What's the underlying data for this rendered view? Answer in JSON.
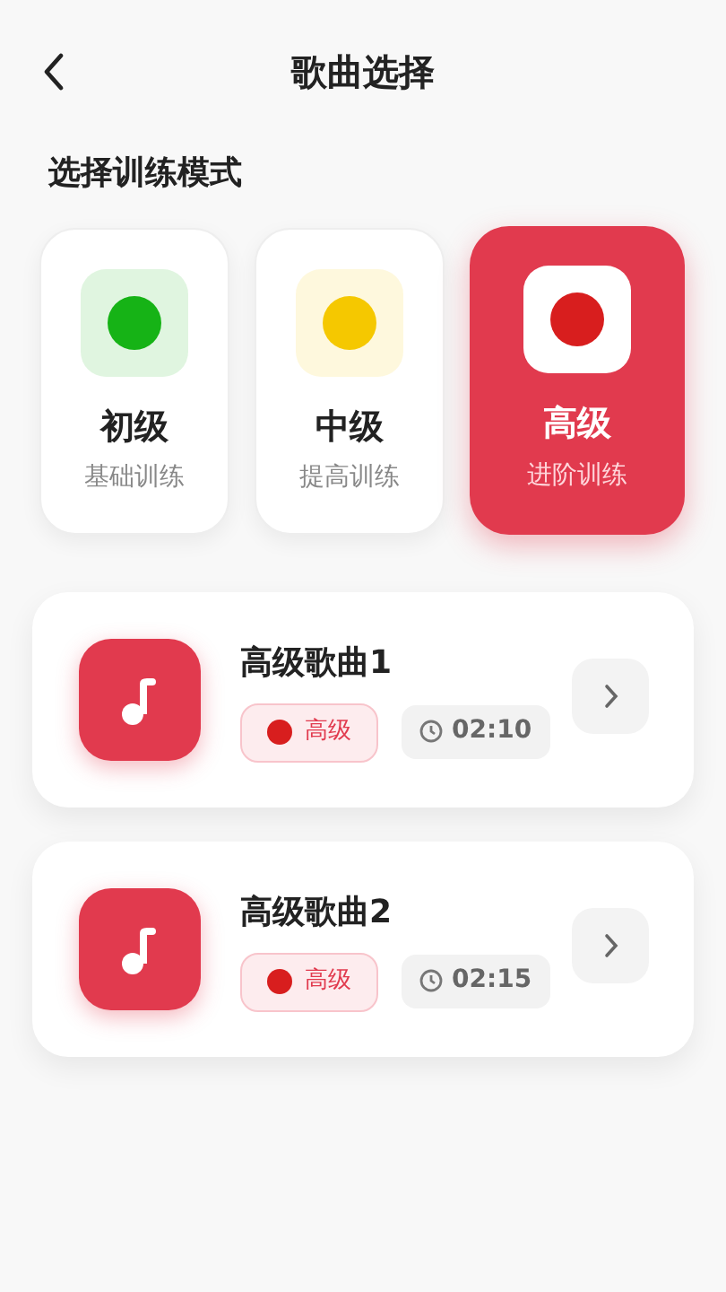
{
  "header": {
    "title": "歌曲选择"
  },
  "section_title": "选择训练模式",
  "modes": [
    {
      "title": "初级",
      "subtitle": "基础训练",
      "color": "#16b316",
      "selected": false
    },
    {
      "title": "中级",
      "subtitle": "提高训练",
      "color": "#f5c800",
      "selected": false
    },
    {
      "title": "高级",
      "subtitle": "进阶训练",
      "color": "#d81e1e",
      "selected": true
    }
  ],
  "songs": [
    {
      "title": "高级歌曲1",
      "level": "高级",
      "color": "#d81e1e",
      "duration": "02:10"
    },
    {
      "title": "高级歌曲2",
      "level": "高级",
      "color": "#d81e1e",
      "duration": "02:15"
    }
  ]
}
